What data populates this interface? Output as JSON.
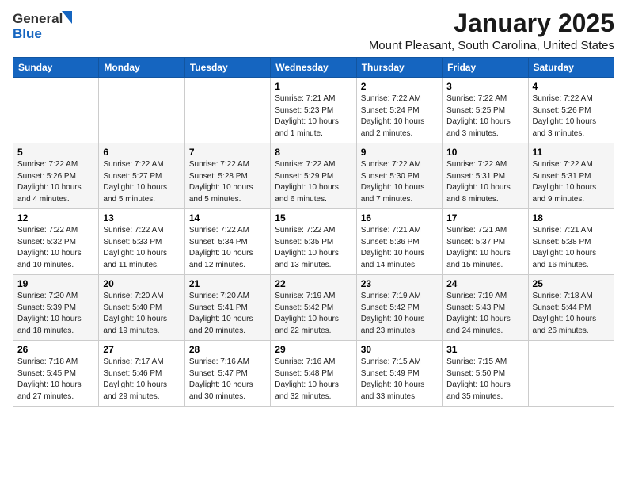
{
  "header": {
    "logo_general": "General",
    "logo_blue": "Blue",
    "title": "January 2025",
    "subtitle": "Mount Pleasant, South Carolina, United States"
  },
  "calendar": {
    "days_of_week": [
      "Sunday",
      "Monday",
      "Tuesday",
      "Wednesday",
      "Thursday",
      "Friday",
      "Saturday"
    ],
    "weeks": [
      [
        {
          "num": "",
          "detail": ""
        },
        {
          "num": "",
          "detail": ""
        },
        {
          "num": "",
          "detail": ""
        },
        {
          "num": "1",
          "detail": "Sunrise: 7:21 AM\nSunset: 5:23 PM\nDaylight: 10 hours\nand 1 minute."
        },
        {
          "num": "2",
          "detail": "Sunrise: 7:22 AM\nSunset: 5:24 PM\nDaylight: 10 hours\nand 2 minutes."
        },
        {
          "num": "3",
          "detail": "Sunrise: 7:22 AM\nSunset: 5:25 PM\nDaylight: 10 hours\nand 3 minutes."
        },
        {
          "num": "4",
          "detail": "Sunrise: 7:22 AM\nSunset: 5:26 PM\nDaylight: 10 hours\nand 3 minutes."
        }
      ],
      [
        {
          "num": "5",
          "detail": "Sunrise: 7:22 AM\nSunset: 5:26 PM\nDaylight: 10 hours\nand 4 minutes."
        },
        {
          "num": "6",
          "detail": "Sunrise: 7:22 AM\nSunset: 5:27 PM\nDaylight: 10 hours\nand 5 minutes."
        },
        {
          "num": "7",
          "detail": "Sunrise: 7:22 AM\nSunset: 5:28 PM\nDaylight: 10 hours\nand 5 minutes."
        },
        {
          "num": "8",
          "detail": "Sunrise: 7:22 AM\nSunset: 5:29 PM\nDaylight: 10 hours\nand 6 minutes."
        },
        {
          "num": "9",
          "detail": "Sunrise: 7:22 AM\nSunset: 5:30 PM\nDaylight: 10 hours\nand 7 minutes."
        },
        {
          "num": "10",
          "detail": "Sunrise: 7:22 AM\nSunset: 5:31 PM\nDaylight: 10 hours\nand 8 minutes."
        },
        {
          "num": "11",
          "detail": "Sunrise: 7:22 AM\nSunset: 5:31 PM\nDaylight: 10 hours\nand 9 minutes."
        }
      ],
      [
        {
          "num": "12",
          "detail": "Sunrise: 7:22 AM\nSunset: 5:32 PM\nDaylight: 10 hours\nand 10 minutes."
        },
        {
          "num": "13",
          "detail": "Sunrise: 7:22 AM\nSunset: 5:33 PM\nDaylight: 10 hours\nand 11 minutes."
        },
        {
          "num": "14",
          "detail": "Sunrise: 7:22 AM\nSunset: 5:34 PM\nDaylight: 10 hours\nand 12 minutes."
        },
        {
          "num": "15",
          "detail": "Sunrise: 7:22 AM\nSunset: 5:35 PM\nDaylight: 10 hours\nand 13 minutes."
        },
        {
          "num": "16",
          "detail": "Sunrise: 7:21 AM\nSunset: 5:36 PM\nDaylight: 10 hours\nand 14 minutes."
        },
        {
          "num": "17",
          "detail": "Sunrise: 7:21 AM\nSunset: 5:37 PM\nDaylight: 10 hours\nand 15 minutes."
        },
        {
          "num": "18",
          "detail": "Sunrise: 7:21 AM\nSunset: 5:38 PM\nDaylight: 10 hours\nand 16 minutes."
        }
      ],
      [
        {
          "num": "19",
          "detail": "Sunrise: 7:20 AM\nSunset: 5:39 PM\nDaylight: 10 hours\nand 18 minutes."
        },
        {
          "num": "20",
          "detail": "Sunrise: 7:20 AM\nSunset: 5:40 PM\nDaylight: 10 hours\nand 19 minutes."
        },
        {
          "num": "21",
          "detail": "Sunrise: 7:20 AM\nSunset: 5:41 PM\nDaylight: 10 hours\nand 20 minutes."
        },
        {
          "num": "22",
          "detail": "Sunrise: 7:19 AM\nSunset: 5:42 PM\nDaylight: 10 hours\nand 22 minutes."
        },
        {
          "num": "23",
          "detail": "Sunrise: 7:19 AM\nSunset: 5:42 PM\nDaylight: 10 hours\nand 23 minutes."
        },
        {
          "num": "24",
          "detail": "Sunrise: 7:19 AM\nSunset: 5:43 PM\nDaylight: 10 hours\nand 24 minutes."
        },
        {
          "num": "25",
          "detail": "Sunrise: 7:18 AM\nSunset: 5:44 PM\nDaylight: 10 hours\nand 26 minutes."
        }
      ],
      [
        {
          "num": "26",
          "detail": "Sunrise: 7:18 AM\nSunset: 5:45 PM\nDaylight: 10 hours\nand 27 minutes."
        },
        {
          "num": "27",
          "detail": "Sunrise: 7:17 AM\nSunset: 5:46 PM\nDaylight: 10 hours\nand 29 minutes."
        },
        {
          "num": "28",
          "detail": "Sunrise: 7:16 AM\nSunset: 5:47 PM\nDaylight: 10 hours\nand 30 minutes."
        },
        {
          "num": "29",
          "detail": "Sunrise: 7:16 AM\nSunset: 5:48 PM\nDaylight: 10 hours\nand 32 minutes."
        },
        {
          "num": "30",
          "detail": "Sunrise: 7:15 AM\nSunset: 5:49 PM\nDaylight: 10 hours\nand 33 minutes."
        },
        {
          "num": "31",
          "detail": "Sunrise: 7:15 AM\nSunset: 5:50 PM\nDaylight: 10 hours\nand 35 minutes."
        },
        {
          "num": "",
          "detail": ""
        }
      ]
    ]
  }
}
